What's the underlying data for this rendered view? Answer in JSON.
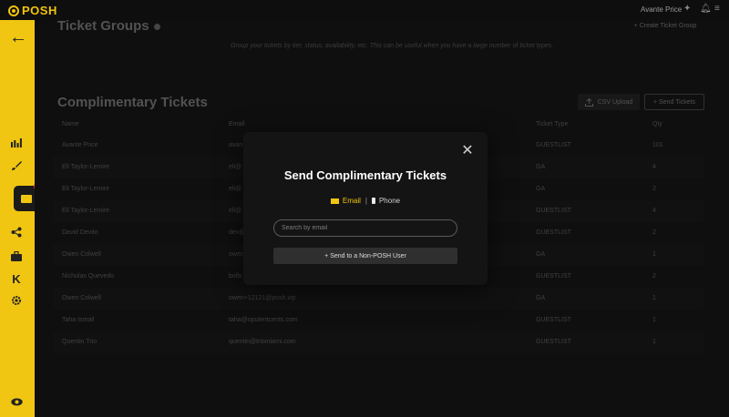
{
  "brand": {
    "name": "POSH",
    "color": "#f0c612"
  },
  "header": {
    "user_name": "Avante Price",
    "icons": [
      "star-icon",
      "bell-icon",
      "menu-icon"
    ]
  },
  "sidebar": {
    "items": [
      {
        "icon": "back-arrow-icon"
      },
      {
        "icon": "analytics-icon"
      },
      {
        "icon": "brush-icon"
      },
      {
        "icon": "tickets-icon",
        "active": true
      },
      {
        "icon": "share-icon"
      },
      {
        "icon": "briefcase-icon"
      },
      {
        "icon": "k-icon"
      },
      {
        "icon": "gear-icon"
      },
      {
        "icon": "eye-icon"
      }
    ]
  },
  "ticket_groups": {
    "title": "Ticket Groups",
    "subtitle": "Group your tickets by tier, status, availability, etc. This can be useful when you have a large number of ticket types.",
    "create_label": "+ Create Ticket Group"
  },
  "complimentary": {
    "title": "Complimentary Tickets",
    "csv_label": "CSV Upload",
    "send_label": "+ Send Tickets",
    "columns": {
      "name": "Name",
      "email": "Email",
      "ticket_type": "Ticket Type",
      "qty": "Qty"
    },
    "rows": [
      {
        "name": "Avante Price",
        "email": "avan",
        "ticket_type": "GUESTLIST",
        "qty": "101"
      },
      {
        "name": "Eli Taylor-Lemire",
        "email": "eli@",
        "ticket_type": "GA",
        "qty": "4"
      },
      {
        "name": "Eli Taylor-Lemire",
        "email": "eli@",
        "ticket_type": "GA",
        "qty": "2"
      },
      {
        "name": "Eli Taylor-Lemire",
        "email": "eli@",
        "ticket_type": "GUESTLIST",
        "qty": "4"
      },
      {
        "name": "David Devito",
        "email": "dev@",
        "ticket_type": "GUESTLIST",
        "qty": "2"
      },
      {
        "name": "Owen Colwell",
        "email": "owen",
        "ticket_type": "GA",
        "qty": "1"
      },
      {
        "name": "Nicholas Quevedo",
        "email": "bolls",
        "ticket_type": "GUESTLIST",
        "qty": "2"
      },
      {
        "name": "Owen Colwell",
        "email": "owen+12121@posh.vip",
        "ticket_type": "GA",
        "qty": "1"
      },
      {
        "name": "Taha Ismail",
        "email": "taha@opulentcents.com",
        "ticket_type": "GUESTLIST",
        "qty": "1"
      },
      {
        "name": "Quentin Trio",
        "email": "quentin@triomiami.com",
        "ticket_type": "GUESTLIST",
        "qty": "1"
      }
    ]
  },
  "modal": {
    "title": "Send Complimentary Tickets",
    "email_tab": "Email",
    "separator": "|",
    "phone_tab": "Phone",
    "search_placeholder": "Search by email",
    "send_nonposh_label": "+ Send to a Non-POSH User"
  }
}
